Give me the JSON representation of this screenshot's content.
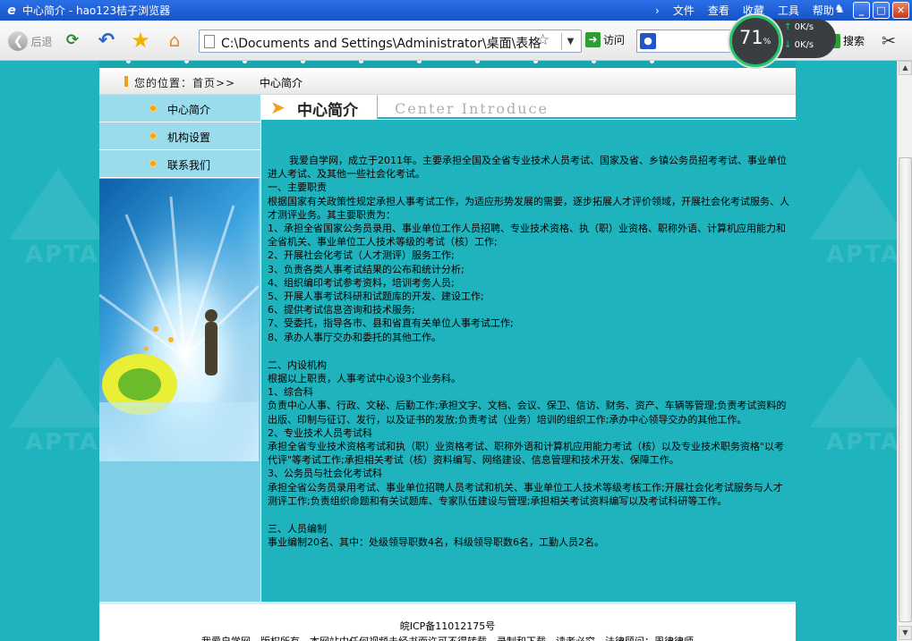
{
  "window": {
    "title": "中心简介 - hao123桔子浏览器",
    "menu": [
      "文件",
      "查看",
      "收藏",
      "工具",
      "帮助"
    ],
    "menu_arrow": "›"
  },
  "toolbar": {
    "back_label": "后退",
    "address": "C:\\Documents and Settings\\Administrator\\桌面\\表格",
    "visit_label": "访问",
    "search_label": "搜索",
    "gauge_value": "71",
    "gauge_unit": "%",
    "upload": "0",
    "download": "0",
    "rate_unit": "K/s"
  },
  "site": {
    "breadcrumb_label": "您的位置：首页>>",
    "breadcrumb_current": "中心简介",
    "sidebar": [
      "中心简介",
      "机构设置",
      "联系我们"
    ],
    "heading": "中心简介",
    "heading_en": "Center Introduce",
    "watermark": "APTA",
    "paragraphs": [
      {
        "text": "我爱自学网，成立于2011年。主要承担全国及全省专业技术人员考试、国家及省、乡镇公务员招考考试、事业单位进人考试、及其他一些社会化考试。",
        "indent": true
      },
      {
        "text": "一、主要职责"
      },
      {
        "text": "根据国家有关政策性规定承担人事考试工作，为适应形势发展的需要，逐步拓展人才评价领域，开展社会化考试服务、人才测评业务。其主要职责为："
      },
      {
        "text": "1、承担全省国家公务员录用、事业单位工作人员招聘、专业技术资格、执（职）业资格、职称外语、计算机应用能力和全省机关、事业单位工人技术等级的考试（核）工作;"
      },
      {
        "text": "2、开展社会化考试（人才测评）服务工作;"
      },
      {
        "text": "3、负责各类人事考试结果的公布和统计分析;"
      },
      {
        "text": "4、组织编印考试参考资料，培训考务人员;"
      },
      {
        "text": "5、开展人事考试科研和试题库的开发、建设工作;"
      },
      {
        "text": "6、提供考试信息咨询和技术服务;"
      },
      {
        "text": "7、受委托，指导各市、县和省直有关单位人事考试工作;"
      },
      {
        "text": "8、承办人事厅交办和委托的其他工作。"
      },
      {
        "gap": true
      },
      {
        "text": "二、内设机构"
      },
      {
        "text": "根据以上职责，人事考试中心设3个业务科。"
      },
      {
        "text": "1、综合科"
      },
      {
        "text": "负责中心人事、行政、文秘、后勤工作;承担文字、文档、会议、保卫、信访、财务、资产、车辆等管理;负责考试资料的出版、印制与征订、发行，以及证书的发放;负责考试（业务）培训的组织工作;承办中心领导交办的其他工作。"
      },
      {
        "text": "2、专业技术人员考试科"
      },
      {
        "text": "承担全省专业技术资格考试和执（职）业资格考试、职称外语和计算机应用能力考试（核）以及专业技术职务资格\"以考代评\"等考试工作;承担相关考试（核）资料编写、网络建设、信息管理和技术开发、保障工作。"
      },
      {
        "text": "3、公务员与社会化考试科"
      },
      {
        "text": "承担全省公务员录用考试、事业单位招聘人员考试和机关、事业单位工人技术等级考核工作;开展社会化考试服务与人才测评工作;负责组织命题和有关试题库、专家队伍建设与管理;承担相关考试资料编写以及考试科研等工作。"
      },
      {
        "gap": true
      },
      {
        "text": "三、人员编制"
      },
      {
        "text": "事业编制20名、其中：处级领导职数4名，科级领导职数6名，工勤人员2名。"
      }
    ],
    "footer_icp": "皖ICP备11012175号",
    "footer_copy": "我爱自学网　版权所有　本网站中任何视频未经书面许可不得转载、录制和下载。读者必究。法律顾问：周律律师"
  },
  "colors": {
    "page_bg": "#1fb3bd",
    "sidebar": "#7ecfe6",
    "accent": "#f0a020",
    "titlebar": "#2b6fe6"
  }
}
